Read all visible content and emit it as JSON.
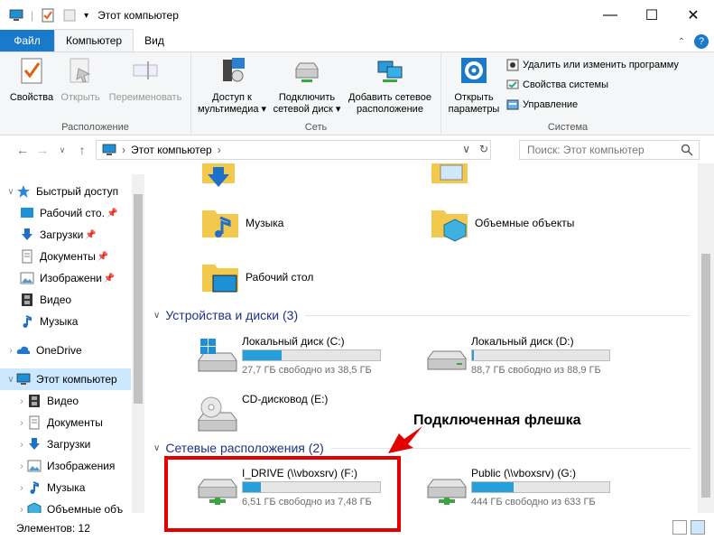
{
  "window": {
    "title": "Этот компьютер"
  },
  "tabs": {
    "file": "Файл",
    "computer": "Компьютер",
    "view": "Вид"
  },
  "ribbon": {
    "location_group": {
      "label": "Расположение",
      "properties": "Свойства",
      "open": "Открыть",
      "rename": "Переименовать"
    },
    "network_group": {
      "label": "Сеть",
      "media_access_1": "Доступ к",
      "media_access_2": "мультимедиа",
      "map_drive_1": "Подключить",
      "map_drive_2": "сетевой диск",
      "add_location_1": "Добавить сетевое",
      "add_location_2": "расположение"
    },
    "system_group": {
      "label": "Система",
      "open_settings_1": "Открыть",
      "open_settings_2": "параметры",
      "uninstall": "Удалить или изменить программу",
      "system_props": "Свойства системы",
      "manage": "Управление"
    }
  },
  "address": {
    "crumb": "Этот компьютер",
    "search_placeholder": "Поиск: Этот компьютер"
  },
  "nav": {
    "quick_access": "Быстрый доступ",
    "desktop": "Рабочий сто.",
    "downloads": "Загрузки",
    "documents": "Документы",
    "images": "Изображени",
    "video": "Видео",
    "music": "Музыка",
    "onedrive": "OneDrive",
    "this_pc": "Этот компьютер",
    "pc_video": "Видео",
    "pc_documents": "Документы",
    "pc_downloads": "Загрузки",
    "pc_images": "Изображения",
    "pc_music": "Музыка",
    "pc_3d": "Объемные объ"
  },
  "folders": {
    "music": "Музыка",
    "objects3d": "Объемные объекты",
    "desktop": "Рабочий стол"
  },
  "sections": {
    "devices": "Устройства и диски (3)",
    "network": "Сетевые расположения (2)"
  },
  "drives": {
    "c": {
      "name": "Локальный диск (C:)",
      "free": "27,7 ГБ свободно из 38,5 ГБ",
      "used_fraction": 0.28
    },
    "d": {
      "name": "Локальный диск (D:)",
      "free": "88,7 ГБ свободно из 88,9 ГБ",
      "used_fraction": 0.01
    },
    "e": {
      "name": "CD-дисковод (E:)"
    },
    "f": {
      "name": "I_DRIVE (\\\\vboxsrv) (F:)",
      "free": "6,51 ГБ свободно из 7,48 ГБ",
      "used_fraction": 0.13
    },
    "g": {
      "name": "Public (\\\\vboxsrv) (G:)",
      "free": "444 ГБ свободно из 633 ГБ",
      "used_fraction": 0.3
    }
  },
  "annotation": {
    "text": "Подключенная флешка"
  },
  "status": {
    "count": "Элементов: 12"
  },
  "colors": {
    "accent": "#1979ca",
    "selection": "#cce8ff",
    "annotation": "#e50000",
    "bar_fill": "#26a0da"
  }
}
